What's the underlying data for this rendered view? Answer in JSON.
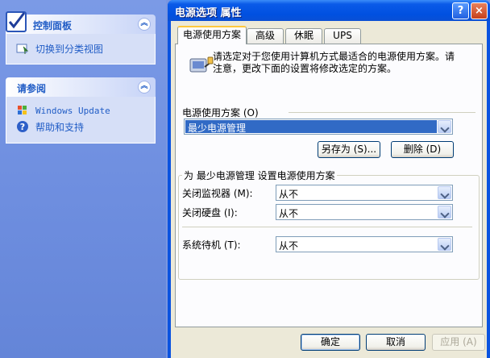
{
  "left_pane": {
    "control_panel": {
      "title": "控制面板",
      "link": "切换到分类视图"
    },
    "see_also": {
      "title": "请参阅",
      "links": [
        "Windows Update",
        "帮助和支持"
      ]
    }
  },
  "dialog": {
    "title": "电源选项 属性",
    "help_button": "?",
    "close_button": "×",
    "tabs": [
      "电源使用方案",
      "高级",
      "休眠",
      "UPS"
    ],
    "intro": "请选定对于您使用计算机方式最适合的电源使用方案。请注意，更改下面的设置将修改选定的方案。",
    "scheme_label": "电源使用方案 (O)",
    "scheme_value": "最少电源管理",
    "save_as_button": "另存为 (S)...",
    "delete_button": "删除 (D)",
    "settings_title": "为 最少电源管理 设置电源使用方案",
    "settings": [
      {
        "label": "关闭监视器 (M):",
        "value": "从不"
      },
      {
        "label": "关闭硬盘 (I):",
        "value": "从不"
      },
      {
        "label": "系统待机 (T):",
        "value": "从不"
      }
    ],
    "ok_button": "确定",
    "cancel_button": "取消",
    "apply_button": "应用 (A)"
  },
  "colors": {
    "titlebar": "#0050e0",
    "taskpane_link": "#215dc6",
    "selection": "#316ac5",
    "dialog_face": "#ece9d8"
  }
}
